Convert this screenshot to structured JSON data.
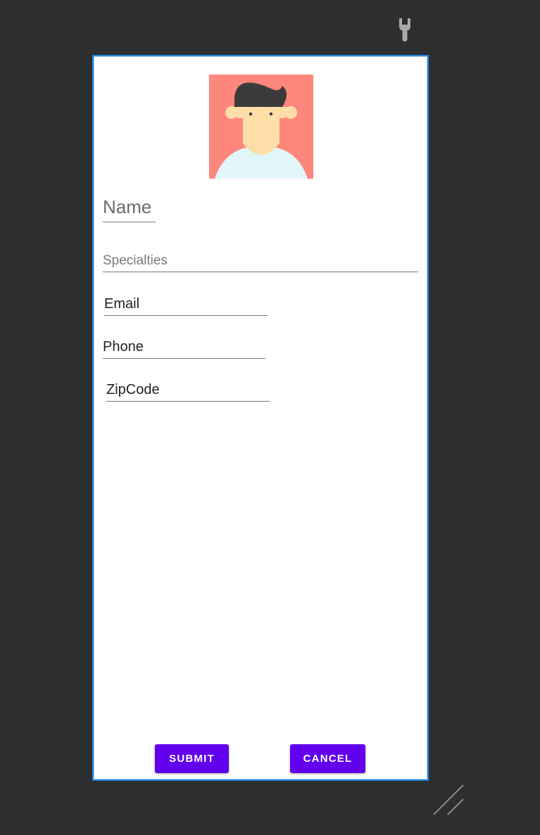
{
  "form": {
    "name_placeholder": "Name",
    "specialties_placeholder": "Specialties",
    "email_label": "Email",
    "phone_label": "Phone",
    "zipcode_label": "ZipCode"
  },
  "buttons": {
    "submit_label": "SUBMIT",
    "cancel_label": "CANCEL"
  },
  "icons": {
    "tool": "wrench-icon",
    "avatar": "avatar-placeholder",
    "resize": "resize-handle-icon"
  },
  "colors": {
    "canvas_background": "#2d2e30",
    "frame_border": "#1f86e6",
    "button_primary": "#6200ee",
    "avatar_background": "#fe877d"
  }
}
